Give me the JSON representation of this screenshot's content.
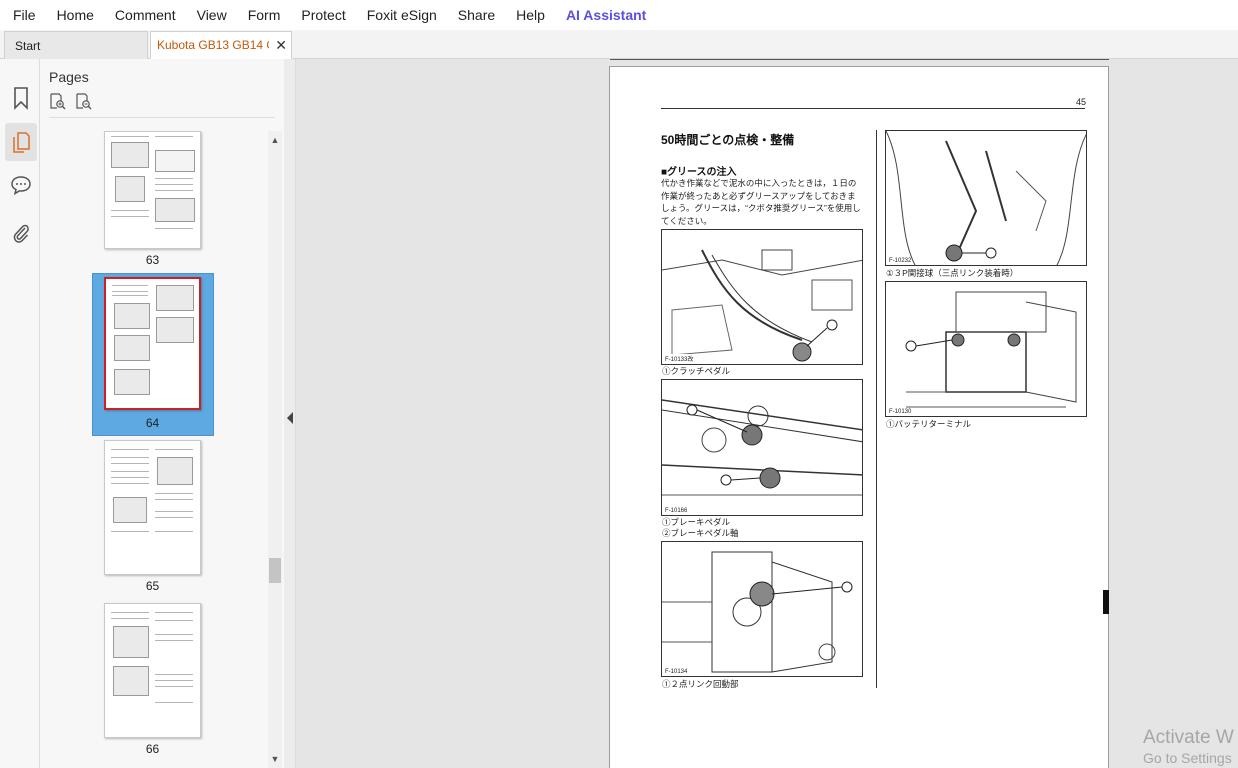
{
  "menu": {
    "items": [
      "File",
      "Home",
      "Comment",
      "View",
      "Form",
      "Protect",
      "Foxit eSign",
      "Share",
      "Help"
    ],
    "ai_label": "AI Assistant"
  },
  "tabs": {
    "start_label": "Start",
    "doc_label": "Kubota GB13 GB14 G...",
    "close_symbol": "✕"
  },
  "rail": {
    "icons": [
      "bookmark-icon",
      "pages-icon",
      "comments-icon",
      "attachments-icon"
    ]
  },
  "pages_panel": {
    "title": "Pages",
    "tools": [
      "page-zoom-in-icon",
      "page-zoom-out-icon"
    ],
    "thumbnails": [
      {
        "label": "63",
        "selected": false
      },
      {
        "label": "64",
        "selected": true
      },
      {
        "label": "65",
        "selected": false
      },
      {
        "label": "66",
        "selected": false
      }
    ]
  },
  "document": {
    "page_number": "45",
    "heading": "50時間ごとの点検・整備",
    "subheading": "■グリースの注入",
    "paragraph": "代かき作業などで泥水の中に入ったときは，１日の作業が終ったあと必ずグリースアップをしておきましょう。グリースは，“クボタ推奨グリース”を使用してください。",
    "figures": {
      "fig1_id": "F-10133改",
      "fig1_caption": "①クラッチペダル",
      "fig2_id": "F-10166",
      "fig2_caption_1": "①ブレーキペダル",
      "fig2_caption_2": "②ブレーキペダル軸",
      "fig3_id": "F-10134",
      "fig3_caption": "①２点リンク回動部",
      "fig4_id": "F-10232",
      "fig4_caption": "①３P関接球（三点リンク装着時）",
      "fig5_id": "F-10130",
      "fig5_caption": "①バッテリターミナル"
    }
  },
  "watermark": {
    "line1": "Activate W",
    "line2": "Go to Settings"
  },
  "colors": {
    "ai_accent": "#5b4fe0",
    "tab_title": "#c25b0c",
    "selection": "#5ea9e2",
    "selected_frame": "#d11f1f"
  }
}
